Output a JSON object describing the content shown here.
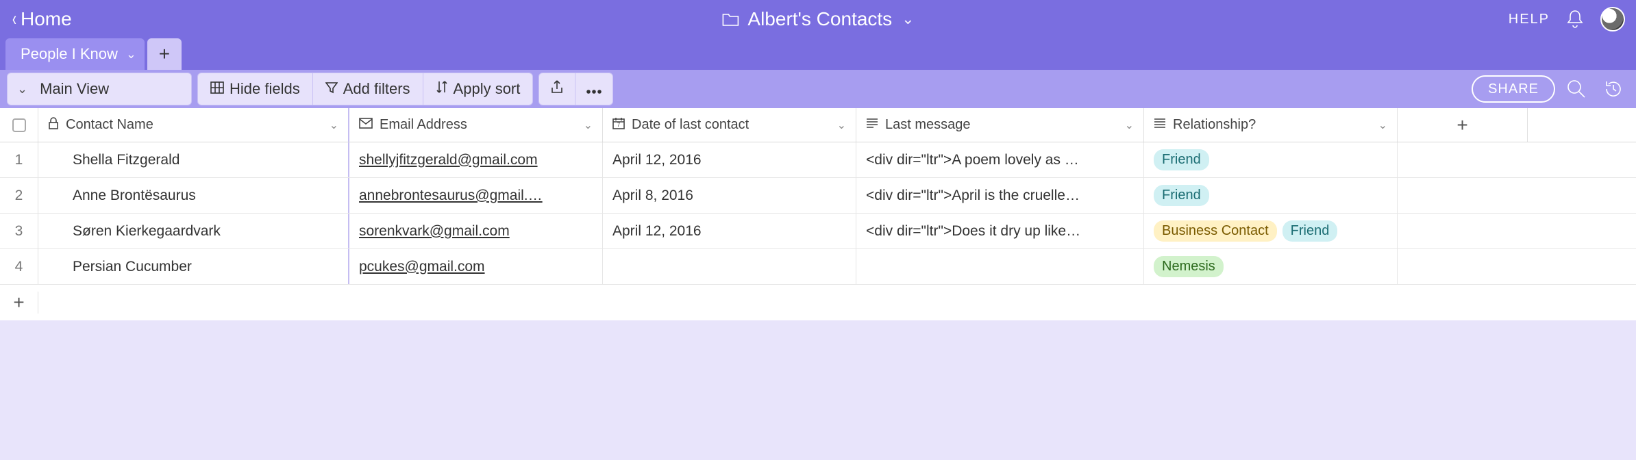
{
  "topbar": {
    "home": "Home",
    "title": "Albert's Contacts",
    "help": "HELP"
  },
  "tabs": {
    "active": "People I Know"
  },
  "toolbar": {
    "view_name": "Main View",
    "hide_fields": "Hide fields",
    "add_filters": "Add filters",
    "apply_sort": "Apply sort",
    "share": "SHARE"
  },
  "columns": {
    "name": "Contact Name",
    "email": "Email Address",
    "date": "Date of last contact",
    "msg": "Last message",
    "rel": "Relationship?"
  },
  "rows": [
    {
      "num": "1",
      "name": "Shella Fitzgerald",
      "email": "shellyjfitzgerald@gmail.com",
      "date": "April 12, 2016",
      "msg": "<div dir=\"ltr\">A poem lovely as …",
      "rel": [
        "Friend"
      ]
    },
    {
      "num": "2",
      "name": "Anne Brontësaurus",
      "email": "annebrontesaurus@gmail.…",
      "date": "April 8, 2016",
      "msg": "<div dir=\"ltr\">April is the cruelle…",
      "rel": [
        "Friend"
      ]
    },
    {
      "num": "3",
      "name": "Søren Kierkegaardvark",
      "email": "sorenkvark@gmail.com",
      "date": "April 12, 2016",
      "msg": "<div dir=\"ltr\">Does it dry up like…",
      "rel": [
        "Business Contact",
        "Friend"
      ]
    },
    {
      "num": "4",
      "name": "Persian Cucumber",
      "email": "pcukes@gmail.com",
      "date": "",
      "msg": "",
      "rel": [
        "Nemesis"
      ]
    }
  ],
  "pill_classes": {
    "Friend": "pill-friend",
    "Business Contact": "pill-business",
    "Nemesis": "pill-nemesis"
  }
}
